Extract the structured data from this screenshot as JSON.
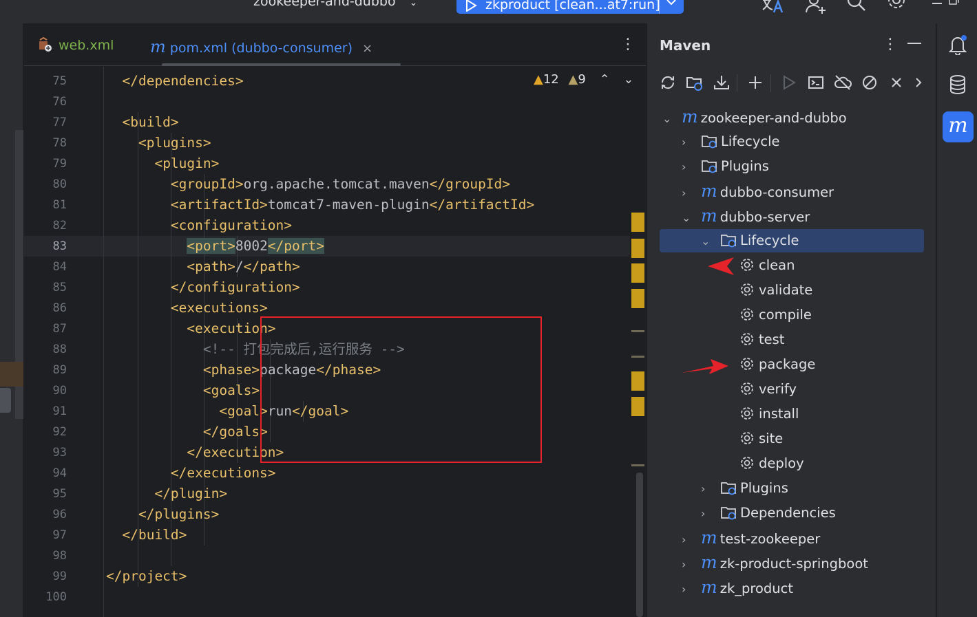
{
  "titlebar": {
    "project": "zookeeper-and-dubbo",
    "run_config": "zkproduct [clean...at7:run]"
  },
  "tabs": [
    {
      "label": "web.xml"
    },
    {
      "label": "pom.xml (dubbo-consumer)",
      "close": "×"
    }
  ],
  "editor": {
    "inspections": {
      "warnings": "12",
      "weak_warnings": "9"
    },
    "line_numbers": [
      "75",
      "76",
      "77",
      "78",
      "79",
      "80",
      "81",
      "82",
      "83",
      "84",
      "85",
      "86",
      "87",
      "88",
      "89",
      "90",
      "91",
      "92",
      "93",
      "94",
      "95",
      "96",
      "97",
      "98",
      "99",
      "100"
    ],
    "current_line": "83",
    "lines": [
      {
        "indent": 2,
        "tag_open": "</dependencies>"
      },
      {
        "indent": 0
      },
      {
        "indent": 2,
        "tag_open": "<build>"
      },
      {
        "indent": 4,
        "tag_open": "<plugins>"
      },
      {
        "indent": 6,
        "tag_open": "<plugin>"
      },
      {
        "indent": 8,
        "tag_open": "<groupId>",
        "text": "org.apache.tomcat.maven",
        "tag_close": "</groupId>"
      },
      {
        "indent": 8,
        "tag_open": "<artifactId>",
        "text": "tomcat7-maven-plugin",
        "tag_close": "</artifactId>"
      },
      {
        "indent": 8,
        "tag_open": "<configuration>"
      },
      {
        "indent": 10,
        "tag_open": "<port>",
        "text": "8002",
        "tag_close": "</port>",
        "highlight": true
      },
      {
        "indent": 10,
        "tag_open": "<path>",
        "text": "/",
        "tag_close": "</path>"
      },
      {
        "indent": 8,
        "tag_open": "</configuration>"
      },
      {
        "indent": 8,
        "tag_open": "<executions>"
      },
      {
        "indent": 10,
        "tag_open": "<execution>"
      },
      {
        "indent": 12,
        "comment": "<!-- 打包完成后,运行服务 -->"
      },
      {
        "indent": 12,
        "tag_open": "<phase>",
        "text": "package",
        "tag_close": "</phase>"
      },
      {
        "indent": 12,
        "tag_open": "<goals>"
      },
      {
        "indent": 14,
        "tag_open": "<goal>",
        "text": "run",
        "tag_close": "</goal>"
      },
      {
        "indent": 12,
        "tag_open": "</goals>"
      },
      {
        "indent": 10,
        "tag_open": "</execution>"
      },
      {
        "indent": 8,
        "tag_open": "</executions>"
      },
      {
        "indent": 6,
        "tag_open": "</plugin>"
      },
      {
        "indent": 4,
        "tag_open": "</plugins>"
      },
      {
        "indent": 2,
        "tag_open": "</build>"
      },
      {
        "indent": 0
      },
      {
        "indent": 0,
        "tag_open": "</project>"
      },
      {
        "indent": 0
      }
    ]
  },
  "maven": {
    "title": "Maven",
    "toolbar_icons": [
      "reload-icon",
      "reload-folder-icon",
      "download-icon",
      "add-icon",
      "run-icon",
      "execute-goal-icon",
      "offline-icon",
      "skip-tests-icon",
      "collapse-icon",
      "more-chevron-icon"
    ],
    "tree": [
      {
        "label": "zookeeper-and-dubbo",
        "type": "module",
        "expanded": true
      },
      {
        "label": "Lifecycle",
        "type": "folder",
        "expanded": false
      },
      {
        "label": "Plugins",
        "type": "folder",
        "expanded": false
      },
      {
        "label": "dubbo-consumer",
        "type": "module",
        "expanded": false
      },
      {
        "label": "dubbo-server",
        "type": "module",
        "expanded": true
      },
      {
        "label": "Lifecycle",
        "type": "folder",
        "expanded": true,
        "selected": true
      },
      {
        "label": "clean",
        "type": "goal"
      },
      {
        "label": "validate",
        "type": "goal"
      },
      {
        "label": "compile",
        "type": "goal"
      },
      {
        "label": "test",
        "type": "goal"
      },
      {
        "label": "package",
        "type": "goal"
      },
      {
        "label": "verify",
        "type": "goal"
      },
      {
        "label": "install",
        "type": "goal"
      },
      {
        "label": "site",
        "type": "goal"
      },
      {
        "label": "deploy",
        "type": "goal"
      },
      {
        "label": "Plugins",
        "type": "folder",
        "expanded": false
      },
      {
        "label": "Dependencies",
        "type": "folder",
        "expanded": false
      },
      {
        "label": "test-zookeeper",
        "type": "module",
        "expanded": false
      },
      {
        "label": "zk-product-springboot",
        "type": "module",
        "expanded": false
      },
      {
        "label": "zk_product",
        "type": "module",
        "expanded": false
      }
    ]
  },
  "colors": {
    "accent": "#3574f0",
    "annotation_red": "#e5232b",
    "xml_tag": "#e8bf6a",
    "warning": "#e0a528"
  }
}
